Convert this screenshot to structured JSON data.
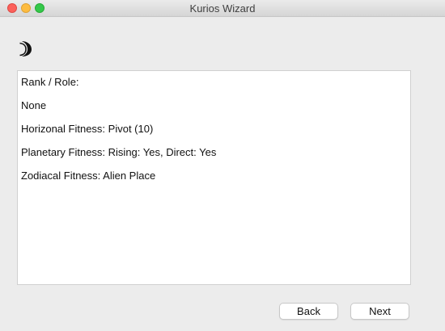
{
  "window": {
    "title": "Kurios Wizard"
  },
  "header": {
    "icon": "moon-icon"
  },
  "panel": {
    "lines": [
      "Rank / Role:",
      "None",
      "Horizonal Fitness: Pivot (10)",
      "Planetary Fitness: Rising: Yes, Direct: Yes",
      "Zodiacal Fitness: Alien Place"
    ]
  },
  "buttons": {
    "back_label": "Back",
    "next_label": "Next"
  },
  "colors": {
    "window_bg": "#ececec",
    "panel_bg": "#ffffff",
    "close": "#fc605b",
    "minimize": "#fdbc40",
    "maximize": "#34c84a"
  }
}
